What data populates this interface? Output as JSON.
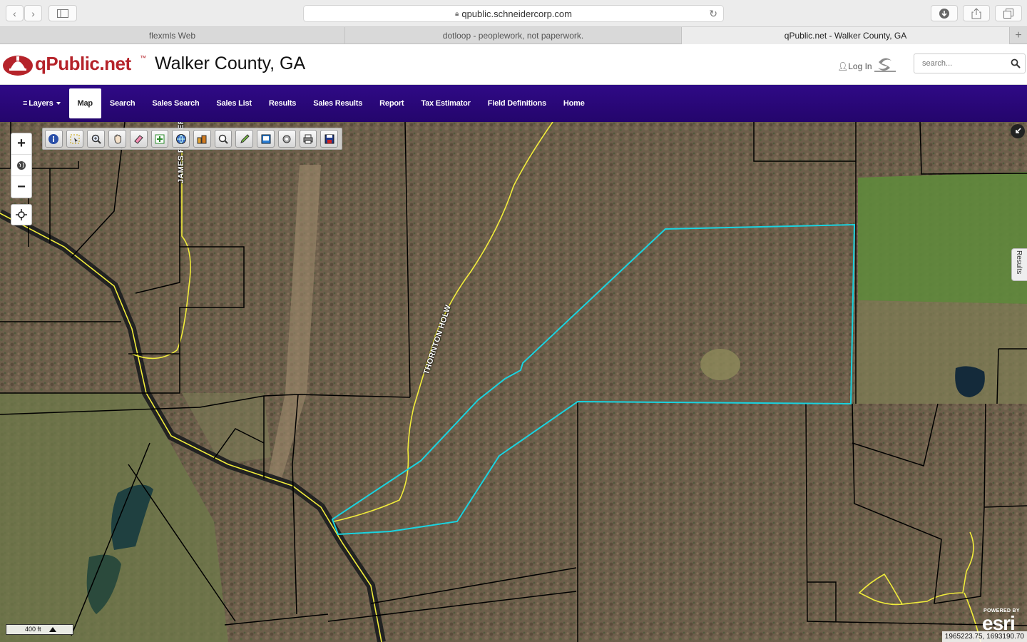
{
  "browser": {
    "url": "qpublic.schneidercorp.com",
    "tabs": [
      {
        "label": "flexmls Web",
        "active": false
      },
      {
        "label": "dotloop - peoplework, not paperwork.",
        "active": false
      },
      {
        "label": "qPublic.net - Walker County, GA",
        "active": true
      }
    ],
    "back_icon": "chevron-left-icon",
    "forward_icon": "chevron-right-icon",
    "sidebar_icon": "sidebar-icon",
    "download_icon": "download-icon",
    "share_icon": "share-icon",
    "tabs_icon": "tabs-overview-icon"
  },
  "header": {
    "logo_text": "qPublic.net",
    "logo_tm": "™",
    "county": "Walker County, GA",
    "login_label": "Log In",
    "search_placeholder": "search..."
  },
  "nav": {
    "items": [
      {
        "label": "Layers",
        "active": false,
        "dropdown": true
      },
      {
        "label": "Map",
        "active": true
      },
      {
        "label": "Search",
        "active": false
      },
      {
        "label": "Sales Search",
        "active": false
      },
      {
        "label": "Sales List",
        "active": false
      },
      {
        "label": "Results",
        "active": false
      },
      {
        "label": "Sales Results",
        "active": false
      },
      {
        "label": "Report",
        "active": false
      },
      {
        "label": "Tax Estimator",
        "active": false
      },
      {
        "label": "Field Definitions",
        "active": false
      },
      {
        "label": "Home",
        "active": false
      }
    ]
  },
  "map": {
    "zoom_in": "+",
    "zoom_out": "−",
    "tools": [
      "info-icon",
      "select-icon",
      "zoom-in-tool-icon",
      "pan-icon",
      "eraser-icon",
      "measure-icon",
      "globe-icon",
      "buildings-icon",
      "magnifier-icon",
      "pencil-icon",
      "print-preview-icon",
      "settings-icon",
      "printer-icon",
      "save-icon"
    ],
    "road_labels": [
      "JAMES FARMER",
      "THORNTON HOLW"
    ],
    "results_tab_label": "Results",
    "scale_label": "400 ft",
    "powered_by": "POWERED BY",
    "esri_brand": "esri",
    "coordinates": "1965223.75, 1693190.70",
    "highlight_color": "#19d3e0",
    "road_color": "#f1ec3b",
    "parcel_line_color": "#000000",
    "nav_color": "#2b067c"
  }
}
